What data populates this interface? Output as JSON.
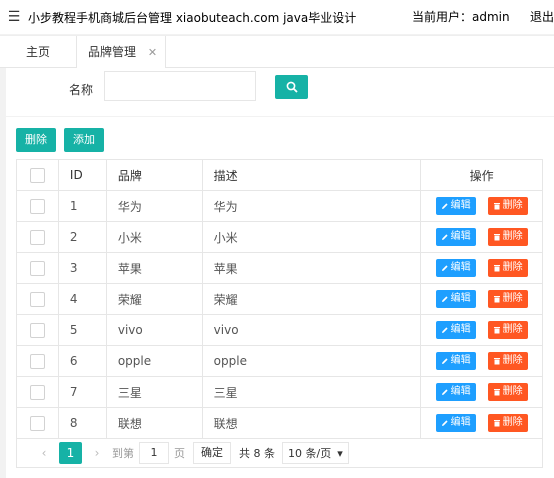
{
  "header": {
    "menu_icon": "☰",
    "title": "小步教程手机商城后台管理 xiaobuteach.com java毕业设计",
    "current_user": "当前用户：admin",
    "logout": "退出"
  },
  "tabs": [
    {
      "label": "主页"
    },
    {
      "label": "品牌管理",
      "close": "✕"
    }
  ],
  "search": {
    "label": "名称",
    "value": "",
    "placeholder": ""
  },
  "toolbar": {
    "delete_label": "删除",
    "add_label": "添加"
  },
  "table": {
    "columns": [
      "",
      "ID",
      "品牌",
      "描述",
      "操作"
    ],
    "rows": [
      {
        "id": "1",
        "brand": "华为",
        "desc": "华为"
      },
      {
        "id": "2",
        "brand": "小米",
        "desc": "小米"
      },
      {
        "id": "3",
        "brand": "苹果",
        "desc": "苹果"
      },
      {
        "id": "4",
        "brand": "荣耀",
        "desc": "荣耀"
      },
      {
        "id": "5",
        "brand": "vivo",
        "desc": "vivo"
      },
      {
        "id": "6",
        "brand": "opple",
        "desc": "opple"
      },
      {
        "id": "7",
        "brand": "三星",
        "desc": "三星"
      },
      {
        "id": "8",
        "brand": "联想",
        "desc": "联想"
      }
    ],
    "edit_label": "编辑",
    "delete_label": "删除"
  },
  "pagination": {
    "prev": "‹",
    "next": "›",
    "current_page": "1",
    "goto_label": "到第",
    "goto_value": "1",
    "page_unit": "页",
    "confirm": "确定",
    "total": "共 8 条",
    "page_size": "10 条/页",
    "page_size_arrow": "▾"
  },
  "colors": {
    "primary": "#16b2a6",
    "edit": "#1e9fff",
    "delete": "#ff5722"
  }
}
